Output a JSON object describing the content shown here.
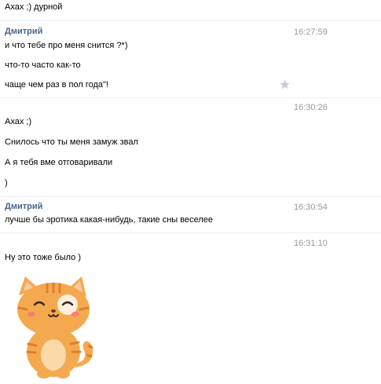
{
  "messages": [
    {
      "text": "Ахах ;) дурной"
    },
    {
      "sender": "Дмитрий",
      "time": "16:27:59",
      "text": "и что тебе про меня снится ?*)"
    },
    {
      "text": "что-то часто как-то"
    },
    {
      "text": "чаще чем раз в пол года\"!"
    },
    {
      "time": "16:30:26",
      "text": "Ахах ;)"
    },
    {
      "text": "Снилось что ты меня замуж звал"
    },
    {
      "text": "А я тебя вме отговаривали"
    },
    {
      "text": ")"
    },
    {
      "sender": "Дмитрий",
      "time": "16:30:54",
      "text": "лучше бы эротика какая-нибудь, такие сны веселее"
    },
    {
      "time": "16:31:10",
      "text": "Ну это тоже было )"
    }
  ],
  "icons": {
    "star": "star-icon",
    "sticker": "cat-sticker"
  },
  "colors": {
    "sender": "#45688e",
    "time": "#999999",
    "star": "#c8cfd9",
    "cat": "#f5a94f"
  }
}
